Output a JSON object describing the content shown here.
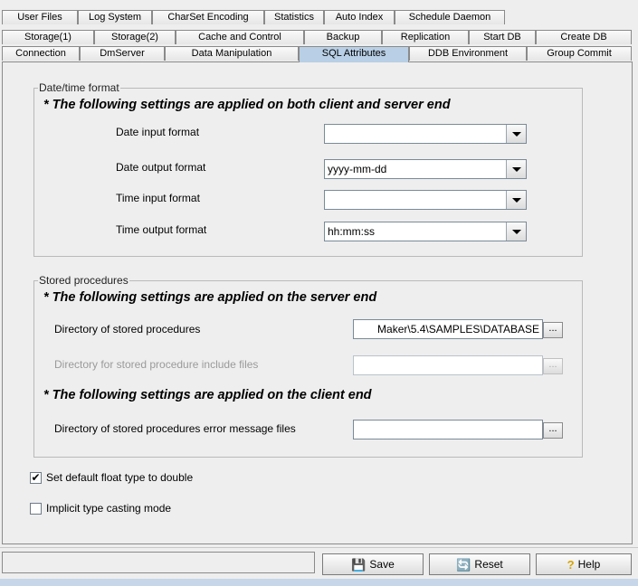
{
  "tabs": {
    "row1": [
      "User Files",
      "Log System",
      "CharSet Encoding",
      "Statistics",
      "Auto Index",
      "Schedule Daemon"
    ],
    "row2": [
      "Storage(1)",
      "Storage(2)",
      "Cache and Control",
      "Backup",
      "Replication",
      "Start DB",
      "Create DB"
    ],
    "row3": [
      "Connection",
      "DmServer",
      "Data Manipulation",
      "SQL Attributes",
      "DDB Environment",
      "Group Commit"
    ],
    "active": "SQL Attributes"
  },
  "datetime": {
    "legend": "Date/time format",
    "note": "* The following settings are applied on both client and server end",
    "date_input_label": "Date input format",
    "date_input_value": "",
    "date_output_label": "Date output format",
    "date_output_value": "yyyy-mm-dd",
    "time_input_label": "Time input format",
    "time_input_value": "",
    "time_output_label": "Time output format",
    "time_output_value": "hh:mm:ss"
  },
  "stored": {
    "legend": "Stored procedures",
    "server_note": "* The following settings are applied on the server end",
    "dir_label": "Directory of stored procedures",
    "dir_value": "Maker\\5.4\\SAMPLES\\DATABASE",
    "include_label": "Directory for stored procedure include files",
    "include_value": "",
    "client_note": "* The following settings are applied on the client end",
    "error_label": "Directory of stored procedures error message files",
    "error_value": "",
    "browse_label": "..."
  },
  "options": {
    "float_label": "Set default float type to double",
    "float_checked": true,
    "implicit_label": "Implicit type casting mode",
    "implicit_checked": false
  },
  "buttons": {
    "save": "Save",
    "reset": "Reset",
    "help": "Help"
  }
}
